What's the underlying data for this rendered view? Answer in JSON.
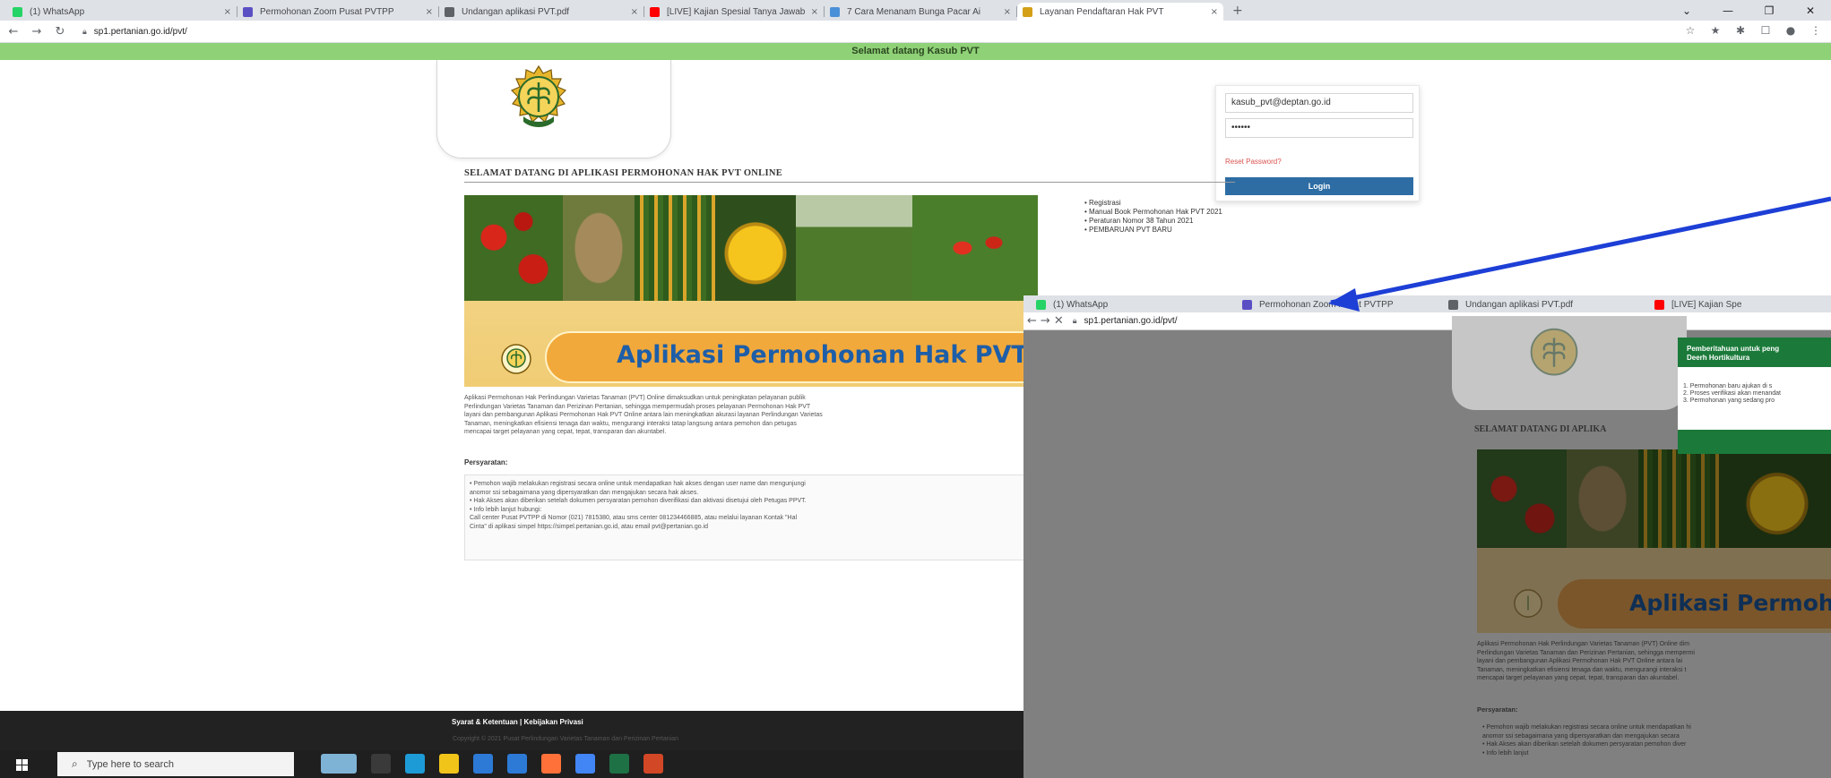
{
  "browser": {
    "tabs": [
      {
        "label": "(1) WhatsApp",
        "close": "×",
        "fav": "#25d366",
        "icon": "whatsapp-icon"
      },
      {
        "label": "Permohonan Zoom Pusat PVTPP",
        "close": "×",
        "fav": "#5b4fc4",
        "icon": "forms-icon"
      },
      {
        "label": "Undangan aplikasi PVT.pdf",
        "close": "×",
        "fav": "#5f6368",
        "icon": "globe-icon"
      },
      {
        "label": "[LIVE] Kajian Spesial Tanya Jawab",
        "close": "×",
        "fav": "#ff0000",
        "icon": "youtube-icon"
      },
      {
        "label": "7 Cara Menanam Bunga Pacar Ai",
        "close": "×",
        "fav": "#4a90d9",
        "icon": "site-icon"
      },
      {
        "label": "Layanan Pendaftaran Hak PVT",
        "close": "×",
        "fav": "#d4a017",
        "icon": "kementan-icon"
      }
    ],
    "new_tab": "+",
    "window_controls": [
      "⌄",
      "—",
      "❐",
      "✕"
    ],
    "url": "sp1.pertanian.go.id/pvt/",
    "toolbar_icons": [
      "☆",
      "★",
      "✱",
      "☐",
      "●",
      "⋮"
    ]
  },
  "page": {
    "greeting_bar": "Selamat datang Kasub PVT",
    "login": {
      "email": "kasub_pvt@deptan.go.id",
      "password": "••••••",
      "forgot": "Reset Password?",
      "button": "Login"
    },
    "welcome_title": "SELAMAT DATANG DI APLIKASI PERMOHONAN HAK PVT ONLINE",
    "links": [
      "Registrasi",
      "Manual Book Permohonan Hak PVT 2021",
      "Peraturan Nomor 38 Tahun 2021",
      "PEMBARUAN PVT BARU"
    ],
    "banner_text": "Aplikasi Permohonan Hak PVT Online",
    "intro": "Aplikasi Permohonan Hak Perlindungan Varietas Tanaman (PVT) Online dimaksudkan untuk peningkatan pelayanan publik\nPerlindungan Varietas Tanaman dan Perizinan Pertanian, sehingga mempermudah proses pelayanan Permohonan Hak PVT\nlayani dan pembangunan Aplikasi Permohonan Hak PVT Online antara lain meningkatkan akurasi layanan Perlindungan Varietas\nTanaman, meningkatkan efisiensi tenaga dan waktu, mengurangi interaksi tatap langsung antara pemohon dan petugas\nmencapai target pelayanan yang cepat, tepat, transparan dan akuntabel.",
    "requirements_title": "Persyaratan:",
    "requirements": "•  Pemohon wajib melakukan registrasi secara online untuk mendapatkan hak akses dengan user name dan mengunjungi\n    anomor ssi sebagaimana yang dipersyaratkan dan mengajukan secara hak akses.\n•  Hak Akses akan diberikan setelah dokumen persyaratan pemohon diverifikasi dan aktivasi disetujui oleh Petugas PPVT.\n•  Info lebih lanjut hubungi:\n    Call center Pusat PVTPP di Nomor (021) 7815380, atau sms center 081234466885, atau melalui layanan Kontak \"Hal\n    Cinta\" di aplikasi simpel https://simpel.pertanian.go.id, atau email pvt@pertanian.go.id",
    "footer_links": "Syarat & Ketentuan   |   Kebijakan Privasi",
    "footer_copy": "Copyright © 2021 Pusat Perlindungan Varietas Tanaman dan Perizinan Pertanian"
  },
  "taskbar": {
    "search_placeholder": "Type here to search",
    "icons": [
      {
        "name": "weather-icon",
        "color": "#7fb3d5"
      },
      {
        "name": "task-view-icon",
        "color": "#3a3a3a"
      },
      {
        "name": "edge-icon",
        "color": "#1d9bd7"
      },
      {
        "name": "explorer-icon",
        "color": "#f0c419"
      },
      {
        "name": "store-icon",
        "color": "#2c7ad6"
      },
      {
        "name": "mail-icon",
        "color": "#2c7ad6"
      },
      {
        "name": "firefox-icon",
        "color": "#ff7139"
      },
      {
        "name": "chrome-icon",
        "color": "#4285f4"
      },
      {
        "name": "excel-icon",
        "color": "#1e7145"
      },
      {
        "name": "powerpoint-icon",
        "color": "#d24726"
      }
    ]
  },
  "overlay": {
    "tabs": [
      {
        "label": "(1) WhatsApp",
        "fav": "#25d366"
      },
      {
        "label": "Permohonan Zoom Pusat PVTPP",
        "fav": "#5b4fc4"
      },
      {
        "label": "Undangan aplikasi PVT.pdf",
        "fav": "#5f6368"
      },
      {
        "label": "[LIVE] Kajian Spe",
        "fav": "#ff0000"
      }
    ],
    "url": "sp1.pertanian.go.id/pvt/",
    "welcome_title": "SELAMAT DATANG DI APLIKA",
    "banner_text": "Aplikasi Permoho",
    "notice_title": "Pemberitahuan untuk peng\nDeerh Hortikultura",
    "notice_items": "1. Permohonan baru ajukan di s\n2. Proses verifikasi akan menandat\n3. Permohonan yang sedang pro",
    "intro": "Aplikasi Permohonan Hak Perlindungan Varietas Tanaman (PVT) Online dim\nPerlindungan Varietas Tanaman dan Perizinan Pertanian, sehingga mempermi\nlayani dan pembangunan Aplikasi Permohonan Hak PVT Online antara lai\nTanaman, meningkatkan efisiensi tenaga dan waktu, mengurangi interaksi t\nmencapai target pelayanan yang cepat, tepat, transparan dan akuntabel.",
    "requirements_title": "Persyaratan:",
    "requirements": "•  Pemohon wajib melakukan registrasi secara online untuk mendapatkan hi\n    anomor ssi sebagaimana yang dipersyaratkan dan mengajukan secara\n•  Hak Akses akan diberikan setelah dokumen persyaratan pemohon diver\n•  Info lebih lanjut"
  },
  "colors": {
    "green_bar": "#8fd177",
    "login_button": "#2e6da4",
    "banner_pill": "#f2a93b",
    "banner_text": "#1e5ea8",
    "arrow": "#1d3fd6"
  }
}
